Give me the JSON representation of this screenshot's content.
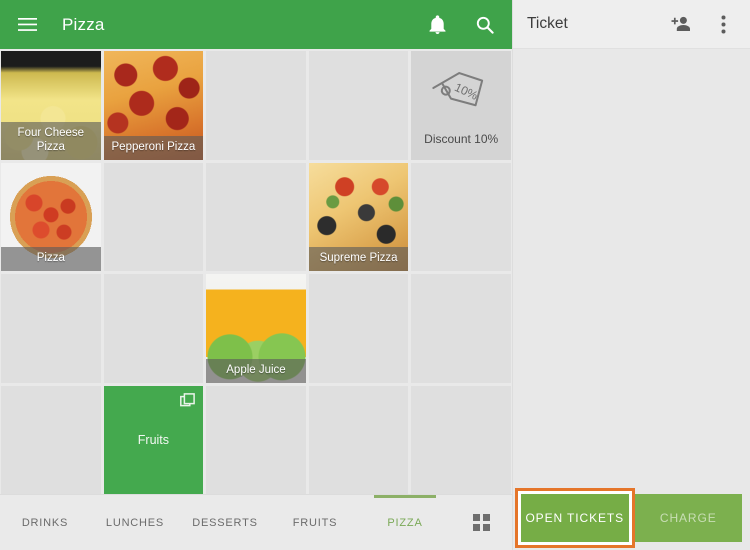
{
  "appbar": {
    "menu_icon": "hamburger-menu-icon",
    "title": "Pizza",
    "notifications_icon": "bell-icon",
    "search_icon": "search-icon",
    "background_color": "#3fa34a"
  },
  "grid": {
    "columns": 5,
    "rows": 4,
    "cells": [
      {
        "type": "product",
        "label": "Four Cheese Pizza",
        "image": "four-cheese-pizza"
      },
      {
        "type": "product",
        "label": "Pepperoni Pizza",
        "image": "pepperoni-pizza"
      },
      {
        "type": "empty",
        "label": ""
      },
      {
        "type": "empty",
        "label": ""
      },
      {
        "type": "action",
        "label": "Discount 10%",
        "icon": "price-tag-icon",
        "icon_text": "10%"
      },
      {
        "type": "product",
        "label": "Pizza",
        "image": "pizza"
      },
      {
        "type": "empty",
        "label": ""
      },
      {
        "type": "empty",
        "label": ""
      },
      {
        "type": "product",
        "label": "Supreme Pizza",
        "image": "supreme-pizza"
      },
      {
        "type": "empty",
        "label": ""
      },
      {
        "type": "empty",
        "label": ""
      },
      {
        "type": "empty",
        "label": ""
      },
      {
        "type": "product",
        "label": "Apple Juice",
        "image": "apple-juice"
      },
      {
        "type": "empty",
        "label": ""
      },
      {
        "type": "empty",
        "label": ""
      },
      {
        "type": "empty",
        "label": ""
      },
      {
        "type": "folder",
        "label": "Fruits",
        "icon": "stacked-squares-icon"
      },
      {
        "type": "empty",
        "label": ""
      },
      {
        "type": "empty",
        "label": ""
      },
      {
        "type": "empty",
        "label": ""
      }
    ]
  },
  "tabs": {
    "items": [
      {
        "label": "DRINKS",
        "active": false
      },
      {
        "label": "LUNCHES",
        "active": false
      },
      {
        "label": "DESSERTS",
        "active": false
      },
      {
        "label": "FRUITS",
        "active": false
      },
      {
        "label": "PIZZA",
        "active": true
      }
    ],
    "grid_view_icon": "grid-view-icon",
    "active_color": "#7aa957"
  },
  "ticket": {
    "title": "Ticket",
    "add_customer_icon": "add-person-icon",
    "overflow_icon": "more-vertical-icon",
    "open_tickets_label": "OPEN TICKETS",
    "charge_label": "CHARGE"
  },
  "annotation": {
    "highlight_color": "#e5752a",
    "target": "open-tickets-button"
  }
}
